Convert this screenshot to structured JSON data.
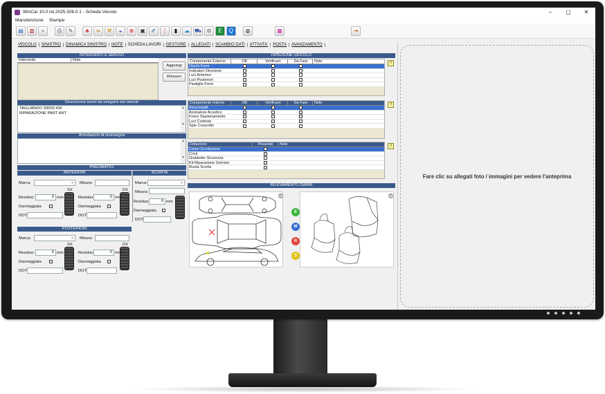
{
  "window": {
    "title": "WinCar 10.0 rel.2025.506.0.1 - Scheda Veicolo",
    "min": "–",
    "max": "▢",
    "close": "✕"
  },
  "menu": [
    "Manutenzione",
    "Stampe"
  ],
  "toolbar_icons": [
    "new-doc-icon",
    "open-doc-icon",
    "search-doc-icon",
    "print-icon",
    "edit-icon",
    "parts-icon",
    "tools-icon",
    "wrench-icon",
    "car-icon",
    "target-icon",
    "camera-icon",
    "pencil-icon",
    "tag-icon",
    "mobile-icon",
    "cloud-icon",
    "cart-icon",
    "settings-icon",
    "excel-icon",
    "q-icon",
    "disk-icon",
    "photo-icon",
    "exit-icon"
  ],
  "tabs": [
    "VEICOLO",
    "SINISTRO",
    "DINAMICA SINISTRO",
    "NOTE",
    "SCHEDA LAVORI",
    "GESTORE",
    "ALLEGATI",
    "SCAMBIO DATI",
    "ATTIVITA'",
    "POSTA",
    "AVANZAMENTO"
  ],
  "interventi": {
    "title": "INTERVENTI E SERVIZI",
    "col_intervento": "Intervento",
    "col_note": "Note",
    "add": "Aggiungi",
    "remove": "Rimuovi"
  },
  "descrizione": {
    "title": "Descrizione lavori da eseguire sul veicolo",
    "line1": "TAGLIANDO 30000 KM",
    "line2": "RIPARAZIONE PART ANT"
  },
  "annotazioni": {
    "title": "Annotazioni di riconsegna"
  },
  "pneumatici": {
    "title": "PNEUMATICI",
    "anteriori": "ANTERIORI",
    "scorta": "SCORTA",
    "posteriori": "POSTERIORI",
    "marca": "Marca:",
    "misura": "Misura:",
    "residuo": "Residuo:",
    "mm": "mm",
    "zero": "0",
    "danneggiata": "Danneggiata",
    "dot": "DOT:",
    "sx": "SX",
    "dx": "DX"
  },
  "ispezione": {
    "title": "ISPEZIONE VEICOLO",
    "ok": "OK",
    "verificare": "Verificare",
    "da_fare": "Da Fare",
    "note": "Note",
    "esterno_head": "Componente Esterno",
    "esterno": [
      "Dischi Freni",
      "Indicatori Direzione",
      "Luci Anteriori",
      "Luci Posteriori",
      "Pastiglie Freni"
    ],
    "interno_head": "Componente Interno",
    "interno": [
      "Alzacristalli",
      "Avvisatore Acustico",
      "Freno Stazionamento",
      "Luci Cortesia",
      "Spie Cruscotto"
    ]
  },
  "dotazione": {
    "head": "Dotazione",
    "presente": "Presente",
    "note": "Note",
    "items": [
      "Carta Circolazione",
      "Crick",
      "Giubbotto Sicurezza",
      "Kit Riparazione Gomme",
      "Ruota Scorta"
    ]
  },
  "rilevamento": {
    "title": "RILEVAMENTO DANNI",
    "buttons": [
      "E",
      "M",
      "R",
      "S"
    ],
    "c": "C",
    "help": "?"
  },
  "preview": {
    "text": "Fare clic su allegati foto / immagini per vedere l'anteprima"
  }
}
